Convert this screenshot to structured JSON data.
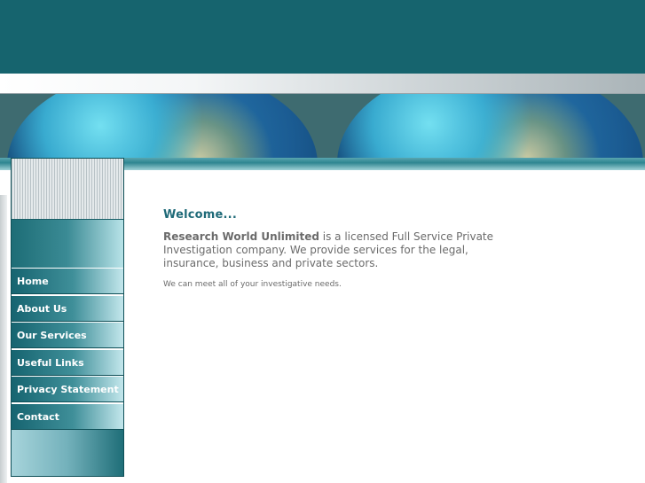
{
  "nav": {
    "items": [
      {
        "label": "Home"
      },
      {
        "label": "About Us"
      },
      {
        "label": "Our Services"
      },
      {
        "label": "Useful Links"
      },
      {
        "label": "Privacy Statement"
      },
      {
        "label": "Contact"
      }
    ]
  },
  "content": {
    "title": "Welcome...",
    "company_name": "Research World Unlimited",
    "intro_rest": " is a licensed Full Service Private Investigation company. We provide services for the legal, insurance, business and private sectors.",
    "note": "We can meet all of your investigative needs."
  },
  "colors": {
    "header_teal": "#16646e",
    "title_teal": "#1f6a78",
    "body_text": "#6b6b6b"
  }
}
